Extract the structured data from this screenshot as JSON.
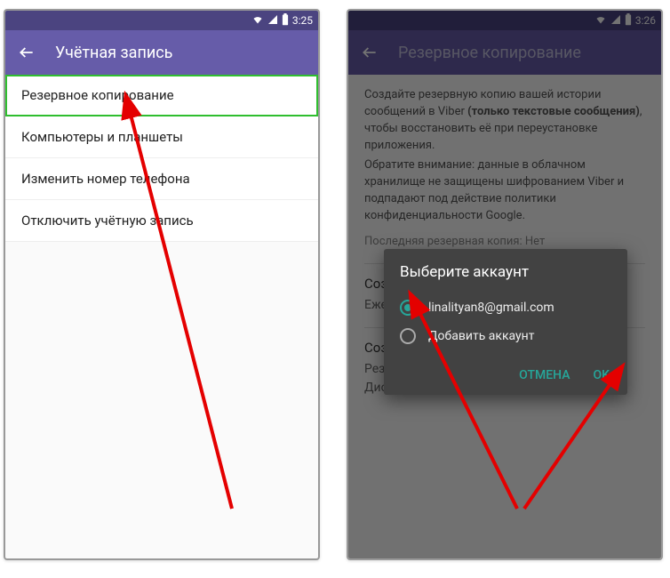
{
  "status": {
    "time_left": "3:25",
    "time_right": "3:26"
  },
  "left": {
    "title": "Учётная запись",
    "items": [
      "Резервное копирование",
      "Компьютеры и планшеты",
      "Изменить номер телефона",
      "Отключить учётную запись"
    ]
  },
  "right": {
    "title": "Резервное копирование",
    "info1a": "Создайте резервную копию вашей истории сообщений в Viber ",
    "info1b": "(только текстовые сообщения)",
    "info1c": ", чтобы восстановить её при переустановке приложения.",
    "info2": "Обратите внимание: данные в облачном хранилище не защищены шифрованием Viber и подпадают под действие политики конфиденциальности Google.",
    "last_backup": "Последняя резервная копия: Нет",
    "section1_title": "Создать копию",
    "section1_sub": "Ежедневно",
    "section2_title": "Создать резервную копию",
    "section2_sub": "Резервная копия будет сохранена на Google Диске для восстановления учётной записи.",
    "dialog": {
      "title": "Выберите аккаунт",
      "account": "linalityan8@gmail.com",
      "add": "Добавить аккаунт",
      "cancel": "ОТМЕНА",
      "ok": "OK"
    }
  }
}
